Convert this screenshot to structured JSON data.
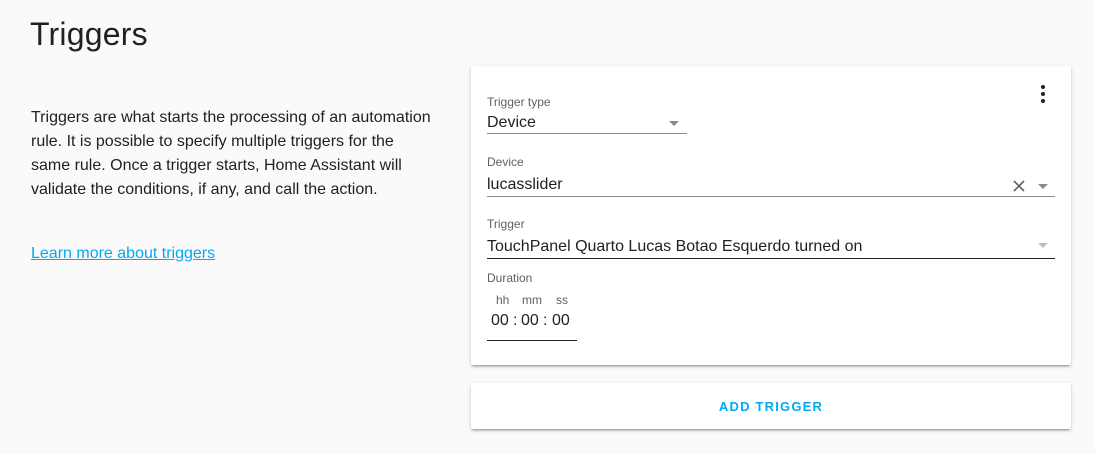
{
  "page": {
    "title": "Triggers",
    "description": "Triggers are what starts the processing of an automation rule. It is possible to specify multiple triggers for the same rule. Once a trigger starts, Home Assistant will validate the conditions, if any, and call the action.",
    "learn_more": "Learn more about triggers"
  },
  "trigger_card": {
    "menu_icon": "dots-vertical-icon",
    "trigger_type": {
      "label": "Trigger type",
      "value": "Device"
    },
    "device": {
      "label": "Device",
      "value": "lucasslider",
      "clear_icon": "close-icon"
    },
    "trigger": {
      "label": "Trigger",
      "value": "TouchPanel Quarto Lucas Botao Esquerdo turned on"
    },
    "duration": {
      "label": "Duration",
      "units": {
        "hours": "hh",
        "minutes": "mm",
        "seconds": "ss"
      },
      "values": {
        "hours": "00",
        "minutes": "00",
        "seconds": "00"
      },
      "separator": ":"
    }
  },
  "add_trigger": {
    "label": "ADD TRIGGER"
  },
  "colors": {
    "accent": "#03a9f4",
    "background": "#fafafa",
    "card": "#ffffff",
    "text_primary": "#212121",
    "text_secondary": "#616161"
  }
}
